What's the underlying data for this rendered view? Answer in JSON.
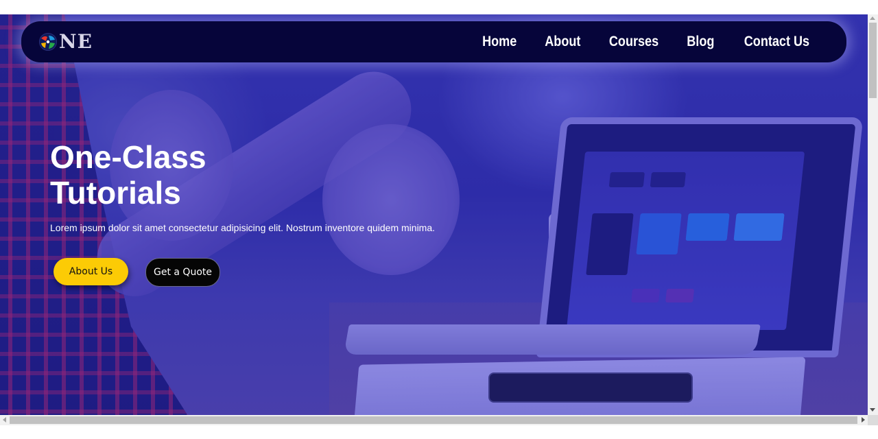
{
  "brand": {
    "logo_text": "NE",
    "logo_icon": "globe-people-icon",
    "logo_colors": [
      "#e8362c",
      "#1e9be0",
      "#f5b400",
      "#27a84a"
    ]
  },
  "nav": {
    "items": [
      {
        "label": "Home"
      },
      {
        "label": "About"
      },
      {
        "label": "Courses"
      },
      {
        "label": "Blog"
      },
      {
        "label": "Contact Us"
      }
    ]
  },
  "hero": {
    "title_line1": "One-Class",
    "title_line2": "Tutorials",
    "subtitle": "Lorem ipsum dolor sit amet consectetur adipisicing elit. Nostrum inventore quidem minima.",
    "primary_button": "About Us",
    "secondary_button": "Get a Quote"
  },
  "colors": {
    "navbar_bg": "#06053a",
    "overlay": "#1c18be",
    "primary_button_bg": "#fccb05",
    "secondary_button_bg": "#050505",
    "text": "#ffffff"
  }
}
